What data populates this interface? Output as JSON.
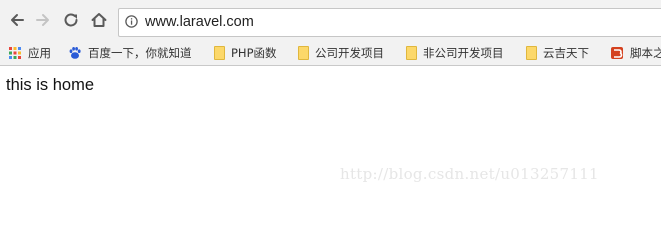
{
  "address_bar": {
    "url": "www.laravel.com"
  },
  "bookmarks": [
    {
      "label": "应用",
      "icon": "apps-grid-icon"
    },
    {
      "label": "百度一下，你就知道",
      "icon": "baidu-paw-icon"
    },
    {
      "label": "PHP函数",
      "icon": "folder-icon"
    },
    {
      "label": "公司开发项目",
      "icon": "folder-icon"
    },
    {
      "label": "非公司开发项目",
      "icon": "folder-icon"
    },
    {
      "label": "云吉天下",
      "icon": "folder-icon"
    },
    {
      "label": "脚本之",
      "icon": "jb51-logo-icon"
    }
  ],
  "page": {
    "body_text": "this is home"
  },
  "watermark": {
    "text": "http://blog.csdn.net/u013257111"
  },
  "colors": {
    "toolbar_bg": "#f2f2f2",
    "folder": "#fcd86a",
    "baidu_blue": "#2a5bd7"
  }
}
